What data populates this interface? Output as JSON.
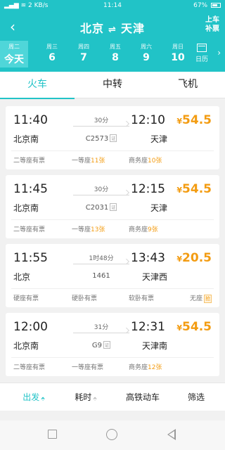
{
  "status": {
    "signal": "▂▄▆ ≋",
    "speed": "2 KB/s",
    "time": "11:14",
    "battery": "67%"
  },
  "header": {
    "from": "北京",
    "swap": "⇌",
    "to": "天津",
    "board_line1": "上车",
    "board_line2": "补票"
  },
  "dates": [
    {
      "weekday": "周二",
      "day": "今天",
      "active": true
    },
    {
      "weekday": "周三",
      "day": "6"
    },
    {
      "weekday": "周四",
      "day": "7"
    },
    {
      "weekday": "周五",
      "day": "8"
    },
    {
      "weekday": "周六",
      "day": "9"
    },
    {
      "weekday": "周日",
      "day": "10"
    }
  ],
  "calendar_label": "日历",
  "tabs": [
    {
      "label": "火车",
      "active": true
    },
    {
      "label": "中转"
    },
    {
      "label": "飞机"
    }
  ],
  "trains": [
    {
      "dep_time": "11:40",
      "arr_time": "12:10",
      "duration": "30分",
      "dep_station": "北京南",
      "arr_station": "天津",
      "train_no": "C2573",
      "tag": "证",
      "price_symbol": "¥",
      "price": "54.5",
      "seats": [
        {
          "label": "二等座有票",
          "num": ""
        },
        {
          "label": "一等座",
          "num": "11张"
        },
        {
          "label": "商务座",
          "num": "10张"
        }
      ]
    },
    {
      "dep_time": "11:45",
      "arr_time": "12:15",
      "duration": "30分",
      "dep_station": "北京南",
      "arr_station": "天津",
      "train_no": "C2031",
      "tag": "证",
      "price_symbol": "¥",
      "price": "54.5",
      "seats": [
        {
          "label": "二等座有票",
          "num": ""
        },
        {
          "label": "一等座",
          "num": "13张"
        },
        {
          "label": "商务座",
          "num": "9张"
        }
      ]
    },
    {
      "dep_time": "11:55",
      "arr_time": "13:43",
      "duration": "1时48分",
      "dep_station": "北京",
      "arr_station": "天津西",
      "train_no": "1461",
      "tag": "",
      "price_symbol": "¥",
      "price": "20.5",
      "seats": [
        {
          "label": "硬座有票",
          "num": ""
        },
        {
          "label": "硬卧有票",
          "num": ""
        },
        {
          "label": "软卧有票",
          "num": ""
        },
        {
          "label": "无座",
          "num": "",
          "grab": "抢"
        }
      ]
    },
    {
      "dep_time": "12:00",
      "arr_time": "12:31",
      "duration": "31分",
      "dep_station": "北京南",
      "arr_station": "天津南",
      "train_no": "G9",
      "tag": "证",
      "price_symbol": "¥",
      "price": "54.5",
      "seats": [
        {
          "label": "二等座有票",
          "num": ""
        },
        {
          "label": "一等座有票",
          "num": ""
        },
        {
          "label": "商务座",
          "num": "12张"
        }
      ]
    }
  ],
  "sort_bar": [
    {
      "label": "出发",
      "caret": "⬘",
      "active": true
    },
    {
      "label": "耗时",
      "caret": "⬘"
    },
    {
      "label": "高铁动车"
    },
    {
      "label": "筛选"
    }
  ],
  "colors": {
    "accent": "#21c3c7",
    "price": "#f39c12"
  }
}
